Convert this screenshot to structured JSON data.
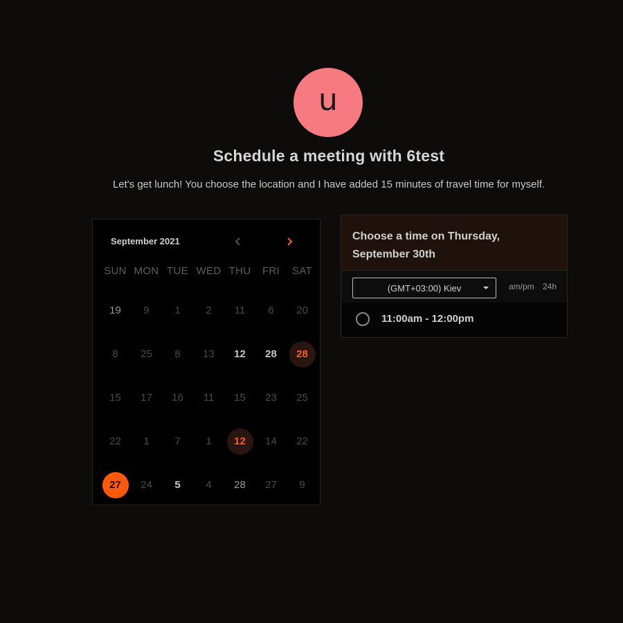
{
  "avatar": {
    "initial": "u",
    "color": "#f77a80"
  },
  "title": "Schedule a meeting with 6test",
  "subtitle": "Let's get lunch! You choose the location and I have added 15 minutes of travel time for myself.",
  "calendar": {
    "month_label": "September 2021",
    "prev_icon": "chevron-left-icon",
    "next_icon": "chevron-right-icon",
    "weekdays": [
      "SUN",
      "MON",
      "TUE",
      "WED",
      "THU",
      "FRI",
      "SAT"
    ],
    "weeks": [
      [
        {
          "label": "19",
          "state": "bright"
        },
        {
          "label": "9",
          "state": "disabled"
        },
        {
          "label": "1",
          "state": "disabled"
        },
        {
          "label": "2",
          "state": "disabled"
        },
        {
          "label": "11",
          "state": "disabled"
        },
        {
          "label": "6",
          "state": "disabled"
        },
        {
          "label": "20",
          "state": "disabled"
        }
      ],
      [
        {
          "label": "8",
          "state": "disabled"
        },
        {
          "label": "25",
          "state": "disabled"
        },
        {
          "label": "8",
          "state": "disabled"
        },
        {
          "label": "13",
          "state": "disabled"
        },
        {
          "label": "12",
          "state": "available"
        },
        {
          "label": "28",
          "state": "available"
        },
        {
          "label": "28",
          "state": "highlight"
        }
      ],
      [
        {
          "label": "15",
          "state": "disabled"
        },
        {
          "label": "17",
          "state": "disabled"
        },
        {
          "label": "16",
          "state": "disabled"
        },
        {
          "label": "11",
          "state": "disabled"
        },
        {
          "label": "15",
          "state": "disabled"
        },
        {
          "label": "23",
          "state": "disabled"
        },
        {
          "label": "25",
          "state": "disabled"
        }
      ],
      [
        {
          "label": "22",
          "state": "disabled"
        },
        {
          "label": "1",
          "state": "disabled"
        },
        {
          "label": "7",
          "state": "disabled"
        },
        {
          "label": "1",
          "state": "disabled"
        },
        {
          "label": "12",
          "state": "highlight"
        },
        {
          "label": "14",
          "state": "disabled"
        },
        {
          "label": "22",
          "state": "disabled"
        }
      ],
      [
        {
          "label": "27",
          "state": "selected"
        },
        {
          "label": "24",
          "state": "disabled"
        },
        {
          "label": "5",
          "state": "available"
        },
        {
          "label": "4",
          "state": "disabled"
        },
        {
          "label": "28",
          "state": "bright"
        },
        {
          "label": "27",
          "state": "disabled"
        },
        {
          "label": "9",
          "state": "disabled"
        }
      ]
    ]
  },
  "time_panel": {
    "heading": "Choose a time on Thursday, September 30th",
    "timezone": "(GMT+03:00) Kiev",
    "format_ampm": "am/pm",
    "format_24": "24h",
    "slots": [
      {
        "label": "11:00am - 12:00pm"
      }
    ]
  },
  "colors": {
    "background": "#0e0c0a",
    "accent": "#ff5a1f",
    "selected": "#ff5a0a"
  }
}
